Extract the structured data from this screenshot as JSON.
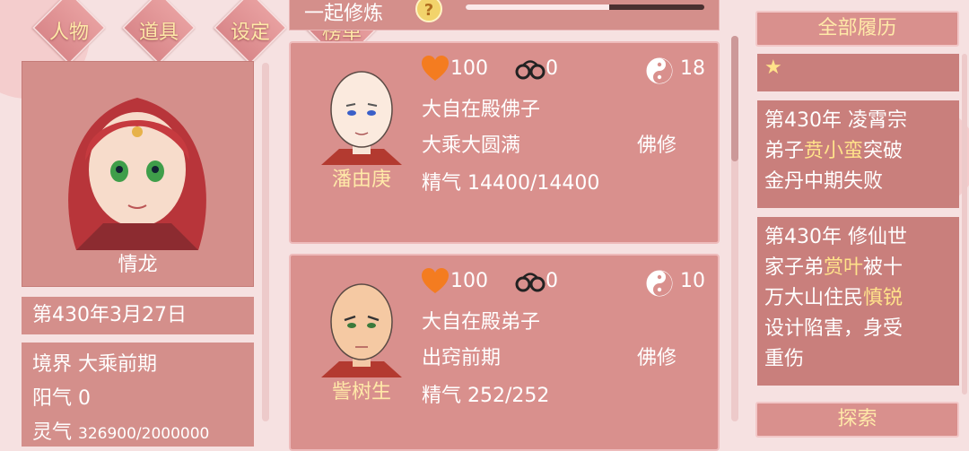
{
  "tabs": [
    {
      "label": "人物"
    },
    {
      "label": "道具"
    },
    {
      "label": "设定"
    },
    {
      "label": "榜单"
    }
  ],
  "character": {
    "name": "情龙",
    "date": "第430年3月27日",
    "stats": {
      "realm_label": "境界",
      "realm_value": "大乘前期",
      "yang_label": "阳气",
      "yang_value": "0",
      "spirit_label": "灵气",
      "spirit_value": "326900/2000000"
    }
  },
  "cultivation_bar": {
    "title": "一起修炼",
    "progress": 0.6
  },
  "disciples": [
    {
      "name": "潘由庚",
      "affection": "100",
      "bonds": "0",
      "yinyang": "18",
      "title": "大自在殿佛子",
      "realm": "大乘大圆满",
      "path": "佛修",
      "essence_label": "精气",
      "essence_value": "14400/14400"
    },
    {
      "name": "訾树生",
      "affection": "100",
      "bonds": "0",
      "yinyang": "10",
      "title": "大自在殿弟子",
      "realm": "出窍前期",
      "path": "佛修",
      "essence_label": "精气",
      "essence_value": "252/252"
    }
  ],
  "history": {
    "header": "全部履历",
    "star": "★",
    "entries": [
      {
        "lines": [
          [
            {
              "t": "第430年 凌霄宗"
            }
          ],
          [
            {
              "t": "弟子"
            },
            {
              "t": "贲小蛮",
              "hl": true
            },
            {
              "t": "突破"
            }
          ],
          [
            {
              "t": "金丹中期失败"
            }
          ]
        ]
      },
      {
        "lines": [
          [
            {
              "t": "第430年 修仙世"
            }
          ],
          [
            {
              "t": "家子弟"
            },
            {
              "t": "赏叶",
              "hl": true
            },
            {
              "t": "被十"
            }
          ],
          [
            {
              "t": "万大山住民"
            },
            {
              "t": "慎锐",
              "hl": true
            }
          ],
          [
            {
              "t": "设计陷害，身受"
            }
          ],
          [
            {
              "t": "重伤"
            }
          ]
        ]
      }
    ],
    "explore": "探索"
  },
  "colors": {
    "panel": "#d48f8b",
    "highlight": "#ffe28a",
    "heart": "#f47c20"
  }
}
